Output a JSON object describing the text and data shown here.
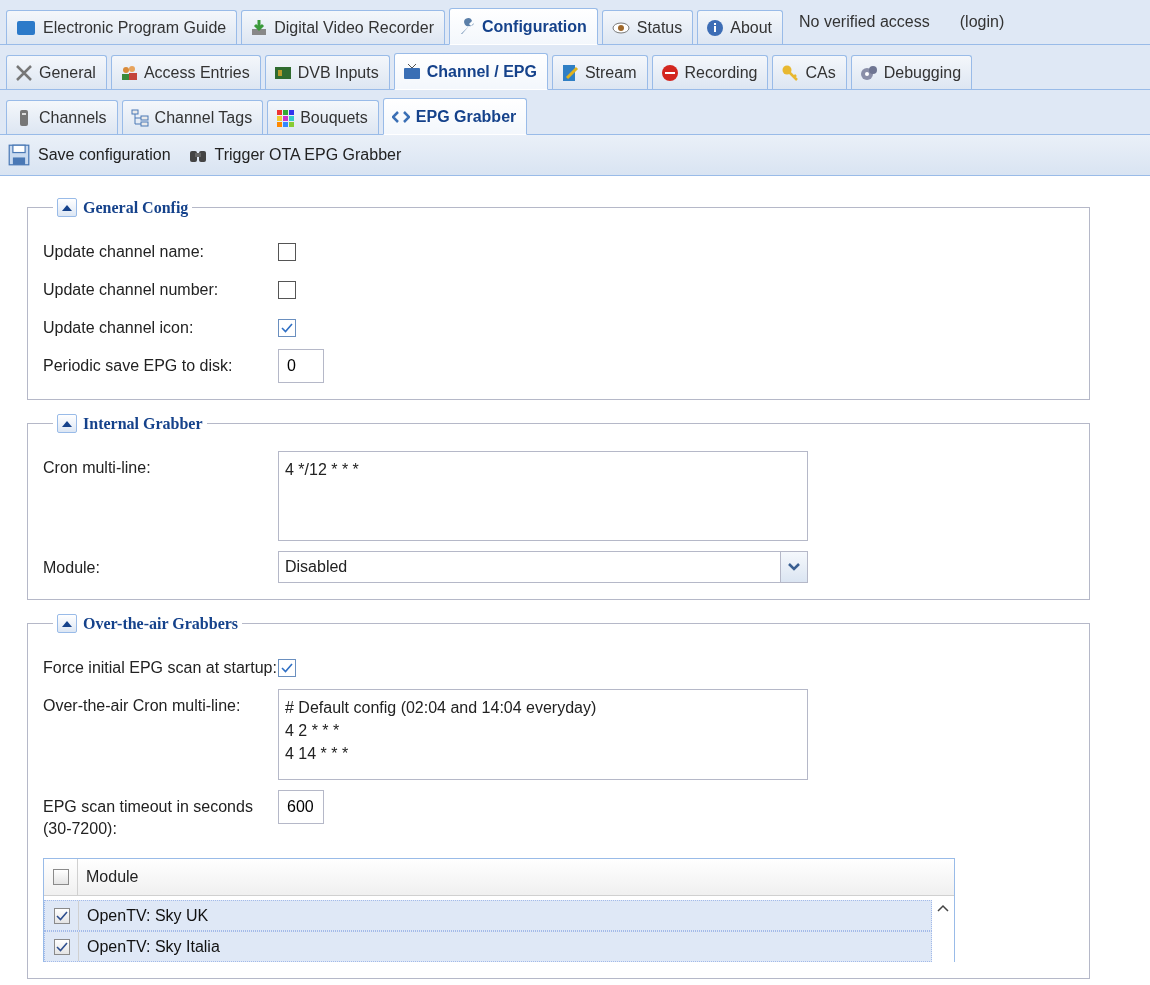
{
  "main_tabs": [
    {
      "label": "Electronic Program Guide",
      "selected": false
    },
    {
      "label": "Digital Video Recorder",
      "selected": false
    },
    {
      "label": "Configuration",
      "selected": true
    },
    {
      "label": "Status",
      "selected": false
    },
    {
      "label": "About",
      "selected": false
    }
  ],
  "access": {
    "status": "No verified access",
    "login": "(login)"
  },
  "config_tabs": [
    {
      "label": "General",
      "selected": false
    },
    {
      "label": "Access Entries",
      "selected": false
    },
    {
      "label": "DVB Inputs",
      "selected": false
    },
    {
      "label": "Channel / EPG",
      "selected": true
    },
    {
      "label": "Stream",
      "selected": false
    },
    {
      "label": "Recording",
      "selected": false
    },
    {
      "label": "CAs",
      "selected": false
    },
    {
      "label": "Debugging",
      "selected": false
    }
  ],
  "epg_tabs": [
    {
      "label": "Channels",
      "selected": false
    },
    {
      "label": "Channel Tags",
      "selected": false
    },
    {
      "label": "Bouquets",
      "selected": false
    },
    {
      "label": "EPG Grabber",
      "selected": true
    }
  ],
  "toolbar": [
    "Save configuration",
    "Trigger OTA EPG Grabber"
  ],
  "sections": [
    {
      "title": "General Config",
      "expanded": true,
      "fields": [
        {
          "kind": "checkbox",
          "label": "Update channel name:",
          "checked": false
        },
        {
          "kind": "checkbox",
          "label": "Update channel number:",
          "checked": false
        },
        {
          "kind": "checkbox",
          "label": "Update channel icon:",
          "checked": true
        },
        {
          "kind": "number",
          "label": "Periodic save EPG to disk:",
          "value": "0"
        }
      ]
    },
    {
      "title": "Internal Grabber",
      "expanded": true,
      "fields": [
        {
          "kind": "textarea",
          "label": "Cron multi-line:",
          "lines": [
            "4 */12 * * *"
          ]
        },
        {
          "kind": "select",
          "label": "Module:",
          "value": "Disabled"
        }
      ]
    },
    {
      "title": "Over-the-air Grabbers",
      "expanded": true,
      "fields": [
        {
          "kind": "checkbox",
          "label": "Force initial EPG scan at startup:",
          "checked": true
        },
        {
          "kind": "textarea",
          "label": "Over-the-air Cron multi-line:",
          "lines": [
            "# Default config (02:04 and 14:04 everyday)",
            "4 2 * * *",
            "4 14 * * *"
          ]
        },
        {
          "kind": "number",
          "label": "EPG scan timeout in seconds (30-7200):",
          "value": "600"
        }
      ],
      "grid": {
        "header_checked": false,
        "column": "Module",
        "rows": [
          {
            "name": "OpenTV: Sky UK",
            "checked": true,
            "selected": true
          },
          {
            "name": "OpenTV: Sky Italia",
            "checked": true,
            "selected": true
          }
        ]
      }
    }
  ]
}
